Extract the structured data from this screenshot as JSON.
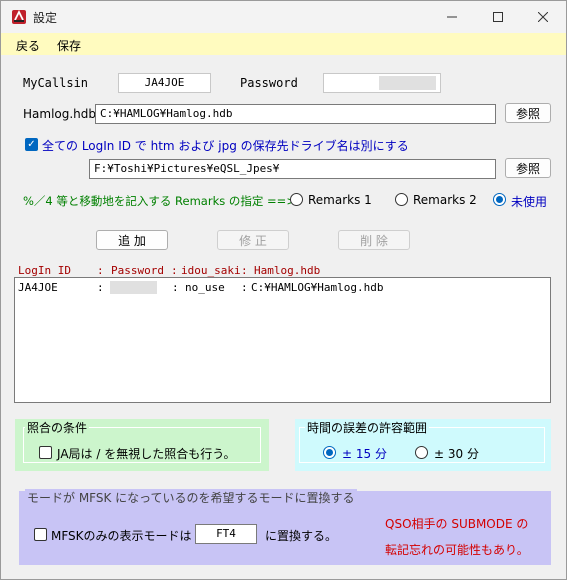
{
  "window": {
    "title": "設定"
  },
  "menu": {
    "back": "戻る",
    "save": "保存"
  },
  "callsign": {
    "label": "MyCallsin",
    "value": "JA4JOE"
  },
  "password": {
    "label": "Password",
    "value": ""
  },
  "hamlog_hdb": {
    "label": "Hamlog.hdb",
    "value": "C:¥HAMLOG¥Hamlog.hdb",
    "browse": "参照"
  },
  "separate_drive": {
    "label": "全ての LogIn ID で htm および jpg の保存先ドライブ名は別にする",
    "checked": true,
    "path": "F:¥Toshi¥Pictures¥eQSL_Jpes¥",
    "browse": "参照"
  },
  "remarks": {
    "label": "%／4 等と移動地を記入する Remarks の指定 ==>",
    "options": [
      {
        "label": "Remarks 1",
        "checked": false
      },
      {
        "label": "Remarks 2",
        "checked": false
      },
      {
        "label": "未使用",
        "checked": true
      }
    ]
  },
  "actions": {
    "add": "追 加",
    "edit": "修 正",
    "delete": "削 除"
  },
  "list": {
    "headers": {
      "login_id": "LogIn ID",
      "sep1": ":",
      "password": "Password",
      "sep2": ":",
      "idou_saki": "idou_saki",
      "sep3": ":",
      "hamlog": "Hamlog.hdb"
    },
    "rows": [
      {
        "login_id": "JA4JOE",
        "sep1": ":",
        "password": "",
        "sep2": ":",
        "idou_saki": "no_use",
        "sep3": ":",
        "hamlog": "C:¥HAMLOG¥Hamlog.hdb"
      }
    ]
  },
  "match": {
    "title": "照合の条件",
    "checkbox_label": "JA局は / を無視した照合も行う。",
    "checked": false
  },
  "time": {
    "title": "時間の誤差の許容範囲",
    "opt15": "± 15 分",
    "opt30": "± 30 分",
    "selected": "15"
  },
  "mfsk": {
    "title": "モードが MFSK になっているのを希望するモードに置換する",
    "checkbox_label": "MFSKのみの表示モードは",
    "checked": false,
    "mode": "FT4",
    "suffix": "に置換する。",
    "note1": "QSO相手の SUBMODE の",
    "note2": "転記忘れの可能性もあり。"
  },
  "colors": {
    "menubar": "#fffbbf",
    "match_bg": "#ccf5cc",
    "time_bg": "#cffafd",
    "mfsk_bg": "#c8c4f5",
    "accent": "#0067c0",
    "header_red": "#a40000",
    "note_red": "#d40000",
    "remarks_green": "#008000",
    "drive_blue": "#0000c0"
  }
}
